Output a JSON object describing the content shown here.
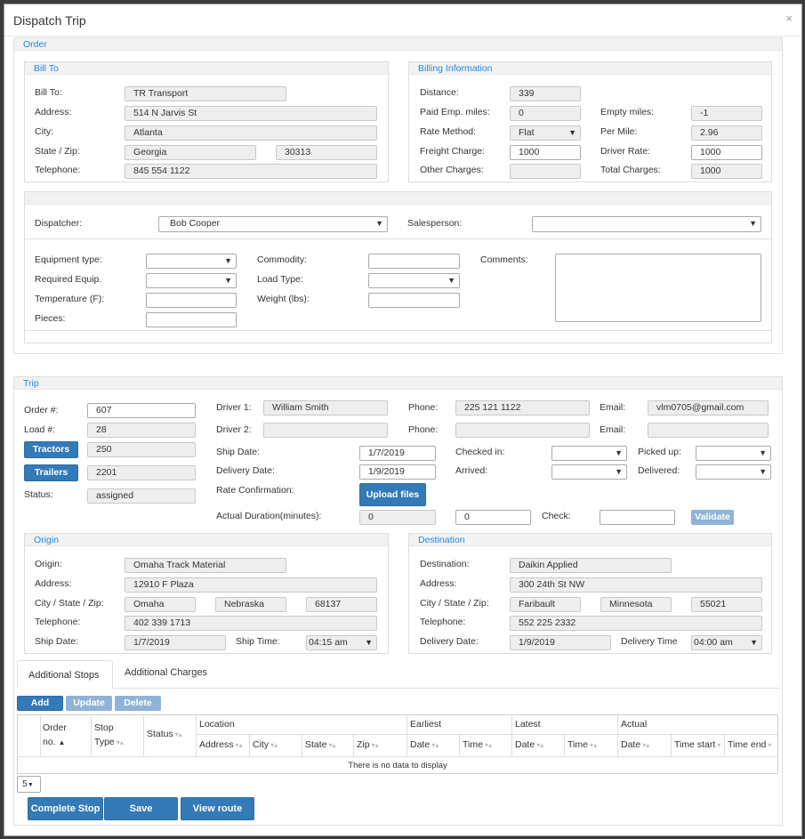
{
  "modal": {
    "title": "Dispatch Trip",
    "close": "×"
  },
  "order": {
    "legend": "Order",
    "billTo": {
      "legend": "Bill To",
      "bill_to_label": "Bill To:",
      "bill_to_value": "TR Transport",
      "address_label": "Address:",
      "address_value": "514 N Jarvis St",
      "city_label": "City:",
      "city_value": "Atlanta",
      "state_zip_label": "State / Zip:",
      "state_value": "Georgia",
      "zip_value": "30313",
      "telephone_label": "Telephone:",
      "telephone_value": "845 554 1122"
    },
    "billing": {
      "legend": "Billing Information",
      "distance_label": "Distance:",
      "distance_value": "339",
      "paid_emp_label": "Paid Emp. miles:",
      "paid_emp_value": "0",
      "empty_miles_label": "Empty miles:",
      "empty_miles_value": "-1",
      "rate_method_label": "Rate Method:",
      "rate_method_value": "Flat",
      "per_mile_label": "Per Mile:",
      "per_mile_value": "2.96",
      "freight_label": "Freight Charge:",
      "freight_value": "1000",
      "driver_rate_label": "Driver Rate:",
      "driver_rate_value": "1000",
      "other_label": "Other Charges:",
      "other_value": "",
      "total_label": "Total Charges:",
      "total_value": "1000"
    },
    "dispatcher_label": "Dispatcher:",
    "dispatcher_value": "Bob Cooper",
    "salesperson_label": "Salesperson:",
    "salesperson_value": "",
    "equipment_label": "Equipment type:",
    "required_equip_label": "Required Equip.",
    "temperature_label": "Temperature (F):",
    "pieces_label": "Pieces:",
    "commodity_label": "Commodity:",
    "load_type_label": "Load Type:",
    "weight_label": "Weight (lbs):",
    "comments_label": "Comments:"
  },
  "trip": {
    "legend": "Trip",
    "order_no_label": "Order #:",
    "order_no_value": "607",
    "load_no_label": "Load #:",
    "load_no_value": "28",
    "tractors_btn": "Tractors",
    "tractors_value": "250",
    "trailers_btn": "Trailers",
    "trailers_value": "2201",
    "status_label": "Status:",
    "status_value": "assigned",
    "driver1_label": "Driver 1:",
    "driver1_value": "William Smith",
    "driver2_label": "Driver 2:",
    "driver2_value": "",
    "phone1_label": "Phone:",
    "phone1_value": "225 121 1122",
    "phone2_label": "Phone:",
    "phone2_value": "",
    "email1_label": "Email:",
    "email1_value": "vlm0705@gmail.com",
    "email2_label": "Email:",
    "email2_value": "",
    "ship_date_label": "Ship Date:",
    "ship_date_value": "1/7/2019",
    "delivery_date_label": "Delivery Date:",
    "delivery_date_value": "1/9/2019",
    "checked_in_label": "Checked in:",
    "arrived_label": "Arrived:",
    "picked_up_label": "Picked up:",
    "delivered_label": "Delivered:",
    "rate_conf_label": "Rate Confirmation:",
    "upload_btn": "Upload files",
    "actual_duration_label": "Actual Duration(minutes):",
    "actual_duration_value": "0",
    "duration_input_value": "0",
    "check_label": "Check:",
    "validate_btn": "Validate"
  },
  "origin": {
    "legend": "Origin",
    "origin_label": "Origin:",
    "origin_value": "Omaha Track Material",
    "address_label": "Address:",
    "address_value": "12910 F Plaza",
    "csz_label": "City / State / Zip:",
    "city_value": "Omaha",
    "state_value": "Nebraska",
    "zip_value": "68137",
    "telephone_label": "Telephone:",
    "telephone_value": "402 339 1713",
    "ship_date_label": "Ship Date:",
    "ship_date_value": "1/7/2019",
    "ship_time_label": "Ship Time:",
    "ship_time_value": "04:15 am"
  },
  "destination": {
    "legend": "Destination",
    "destination_label": "Destination:",
    "destination_value": "Daikin Applied",
    "address_label": "Address:",
    "address_value": "300 24th St NW",
    "csz_label": "City / State / Zip:",
    "city_value": "Faribault",
    "state_value": "Minnesota",
    "zip_value": "55021",
    "telephone_label": "Telephone:",
    "telephone_value": "552 225 2332",
    "delivery_date_label": "Delivery Date:",
    "delivery_date_value": "1/9/2019",
    "delivery_time_label": "Delivery Time",
    "delivery_time_value": "04:00 am"
  },
  "tabs": {
    "stops": "Additional Stops",
    "charges": "Additional Charges"
  },
  "grid": {
    "add": "Add",
    "update": "Update",
    "delete": "Delete",
    "order_no_1": "Order",
    "order_no_2": "no.",
    "stop_type_1": "Stop",
    "stop_type_2": "Type",
    "status": "Status",
    "location": "Location",
    "earliest": "Earliest",
    "latest": "Latest",
    "actual": "Actual",
    "address": "Address",
    "city": "City",
    "state": "State",
    "zip": "Zip",
    "e_date": "Date",
    "e_time": "Time",
    "l_date": "Date",
    "l_time": "Time",
    "a_date": "Date",
    "a_time_start": "Time start",
    "a_time_end": "Time end",
    "empty": "There is no data to display",
    "page_size": "5"
  },
  "footer": {
    "complete_stop": "Complete Stop",
    "save": "Save",
    "view_route": "View route"
  }
}
